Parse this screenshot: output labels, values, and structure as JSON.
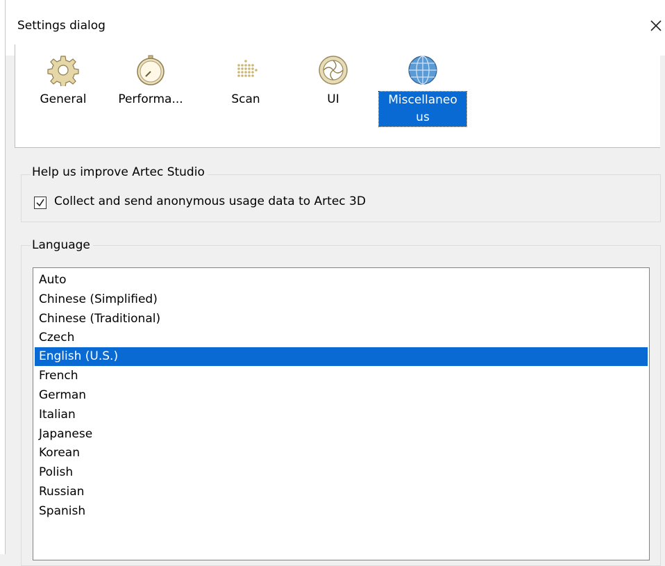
{
  "window": {
    "title": "Settings dialog"
  },
  "toolbar": {
    "items": [
      {
        "label": "General",
        "icon": "gear-icon"
      },
      {
        "label": "Performa...",
        "icon": "stopwatch-icon"
      },
      {
        "label": "Scan",
        "icon": "dot-grid-icon"
      },
      {
        "label": "UI",
        "icon": "aperture-icon"
      },
      {
        "label": "Miscellaneo us",
        "icon": "globe-icon",
        "selected": true
      }
    ]
  },
  "help_group": {
    "title": "Help us improve Artec Studio",
    "checkbox_label": "Collect and send anonymous usage data to Artec 3D",
    "checked": true
  },
  "language_group": {
    "title": "Language",
    "options": [
      "Auto",
      "Chinese (Simplified)",
      "Chinese (Traditional)",
      "Czech",
      "English (U.S.)",
      "French",
      "German",
      "Italian",
      "Japanese",
      "Korean",
      "Polish",
      "Russian",
      "Spanish"
    ],
    "selected": "English (U.S.)"
  },
  "colors": {
    "selection": "#0a6ad3",
    "background": "#f0f0f0"
  }
}
